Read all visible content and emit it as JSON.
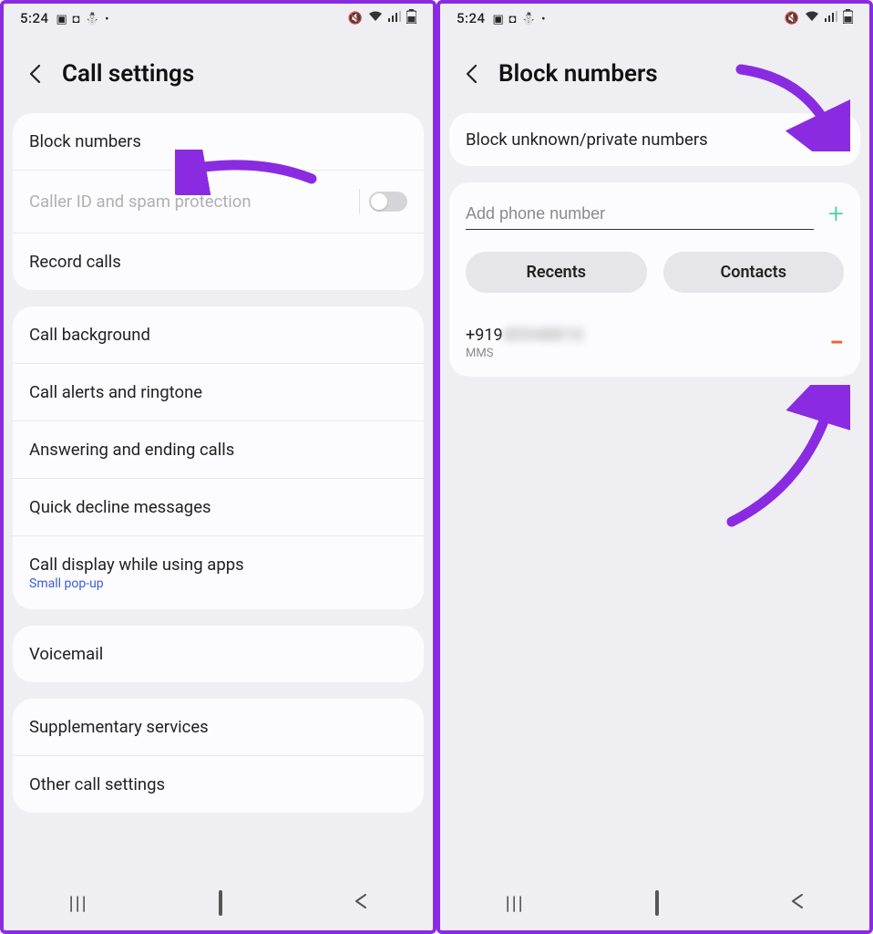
{
  "status": {
    "time": "5:24",
    "left_icons": [
      "image-icon",
      "stop-icon",
      "snowman-icon",
      "dot-icon"
    ],
    "right_icons": [
      "vibrate-icon",
      "wifi-icon",
      "signal-icon",
      "battery-icon"
    ]
  },
  "left_screen": {
    "title": "Call settings",
    "groups": [
      {
        "rows": [
          {
            "label": "Block numbers",
            "type": "link"
          },
          {
            "label": "Caller ID and spam protection",
            "type": "toggle",
            "disabled": true,
            "toggle_on": false
          },
          {
            "label": "Record calls",
            "type": "link"
          }
        ]
      },
      {
        "rows": [
          {
            "label": "Call background",
            "type": "link"
          },
          {
            "label": "Call alerts and ringtone",
            "type": "link"
          },
          {
            "label": "Answering and ending calls",
            "type": "link"
          },
          {
            "label": "Quick decline messages",
            "type": "link"
          },
          {
            "label": "Call display while using apps",
            "sublabel": "Small pop-up",
            "type": "link"
          }
        ]
      },
      {
        "rows": [
          {
            "label": "Voicemail",
            "type": "link"
          }
        ]
      },
      {
        "rows": [
          {
            "label": "Supplementary services",
            "type": "link"
          },
          {
            "label": "Other call settings",
            "type": "link"
          }
        ]
      }
    ]
  },
  "right_screen": {
    "title": "Block numbers",
    "block_unknown": {
      "label": "Block unknown/private numbers",
      "toggle_on": false
    },
    "add_placeholder": "Add phone number",
    "buttons": {
      "recents": "Recents",
      "contacts": "Contacts"
    },
    "blocked_entry": {
      "number_prefix": "+919",
      "number_rest": "40948810",
      "type": "MMS"
    }
  },
  "annotation_color": "#8a2be2"
}
